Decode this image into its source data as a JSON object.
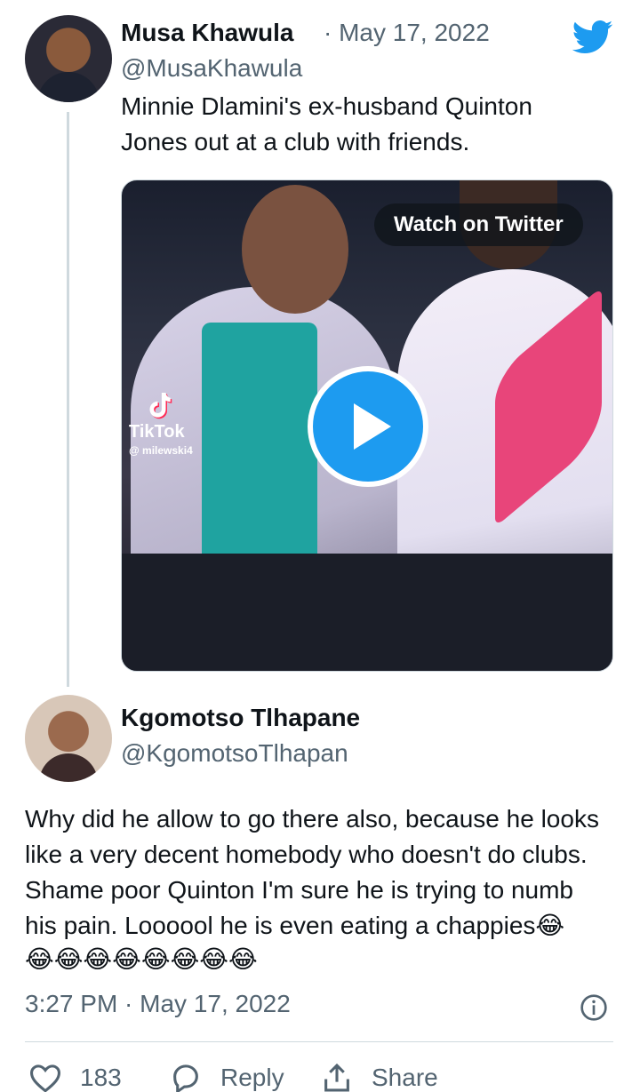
{
  "tweet": {
    "author_name": "Musa Khawula",
    "date": "· May 17, 2022",
    "handle": "@MusaKhawula",
    "text_line1": "Minnie Dlamini's ex-husband Quinton",
    "text_line2": "Jones out at a club with friends.",
    "media": {
      "watch_label": "Watch on Twitter",
      "tiktok_brand": "TikTok",
      "tiktok_user": "@ milewski4"
    }
  },
  "reply": {
    "author_name": "Kgomotso Tlhapane",
    "handle": "@KgomotsoTlhapan",
    "text_line1": "Why did he allow to go there also, because he looks",
    "text_line2": "like a very decent homebody who doesn't do  clubs.",
    "text_line3": "Shame poor Quinton I'm sure he is trying to numb",
    "text_line4": "his pain. Loooool he is even eating a chappies😂",
    "text_line5": "😂😂😂😂😂😂😂😂",
    "timestamp": "3:27 PM · May 17, 2022"
  },
  "actions": {
    "like_count": "183",
    "reply_label": "Reply",
    "share_label": "Share"
  },
  "colors": {
    "twitter_blue": "#1d9bf0",
    "text": "#0f1419",
    "secondary": "#536471",
    "border": "#cfd9de"
  },
  "icons": [
    "twitter-bird-icon",
    "play-icon",
    "tiktok-icon",
    "info-icon",
    "heart-icon",
    "reply-icon",
    "share-icon"
  ]
}
